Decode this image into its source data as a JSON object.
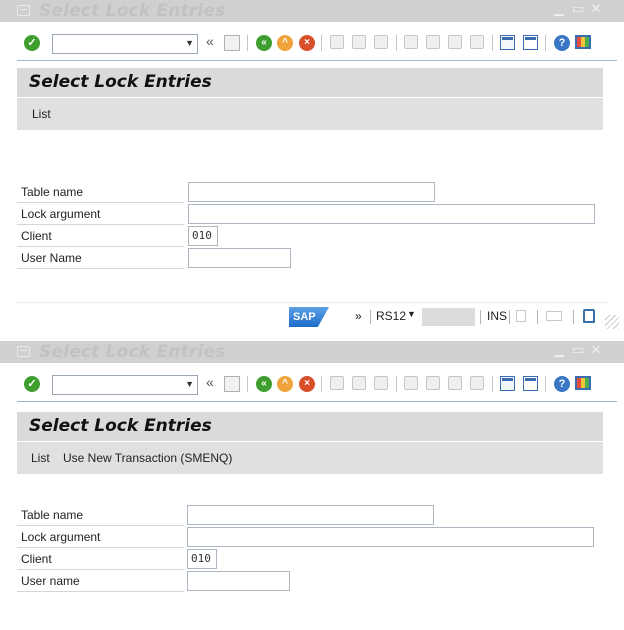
{
  "window1": {
    "title": "Select Lock Entries",
    "header_title": "Select Lock Entries",
    "menu": [
      "List"
    ],
    "fields": [
      {
        "label": "Table name",
        "value": ""
      },
      {
        "label": "Lock argument",
        "value": ""
      },
      {
        "label": "Client",
        "value": "010"
      },
      {
        "label": "User Name",
        "value": ""
      }
    ],
    "status": {
      "expand": "»",
      "system": "RS12",
      "mode": "INS"
    }
  },
  "window2": {
    "title": "Select Lock Entries",
    "header_title": "Select Lock Entries",
    "menu": [
      "List",
      "Use New Transaction (SMENQ)"
    ],
    "fields": [
      {
        "label": "Table name",
        "value": ""
      },
      {
        "label": "Lock argument",
        "value": ""
      },
      {
        "label": "Client",
        "value": "010"
      },
      {
        "label": "User name",
        "value": ""
      }
    ]
  },
  "toolbar": {
    "command_field": "",
    "icons": [
      "enter-icon",
      "command-field",
      "back-double-icon",
      "save-icon",
      "back-icon",
      "exit-icon",
      "cancel-icon",
      "print-icon",
      "find-icon",
      "find-next-icon",
      "first-page-icon",
      "previous-page-icon",
      "next-page-icon",
      "last-page-icon",
      "create-session-icon",
      "generate-shortcut-icon",
      "help-icon",
      "customize-layout-icon"
    ],
    "double_arrow": "«"
  },
  "titlebar_controls": {
    "minimize": "▁",
    "maximize": "▭",
    "close": "✕"
  },
  "colors": {
    "title_bar": "#d0d0d0",
    "header_bg": "#dadada",
    "menu_bg": "#e0e0e0",
    "accent_blue": "#3a6db0",
    "ok_green": "#3e9f2e"
  },
  "branding": {
    "logo": "SAP"
  }
}
